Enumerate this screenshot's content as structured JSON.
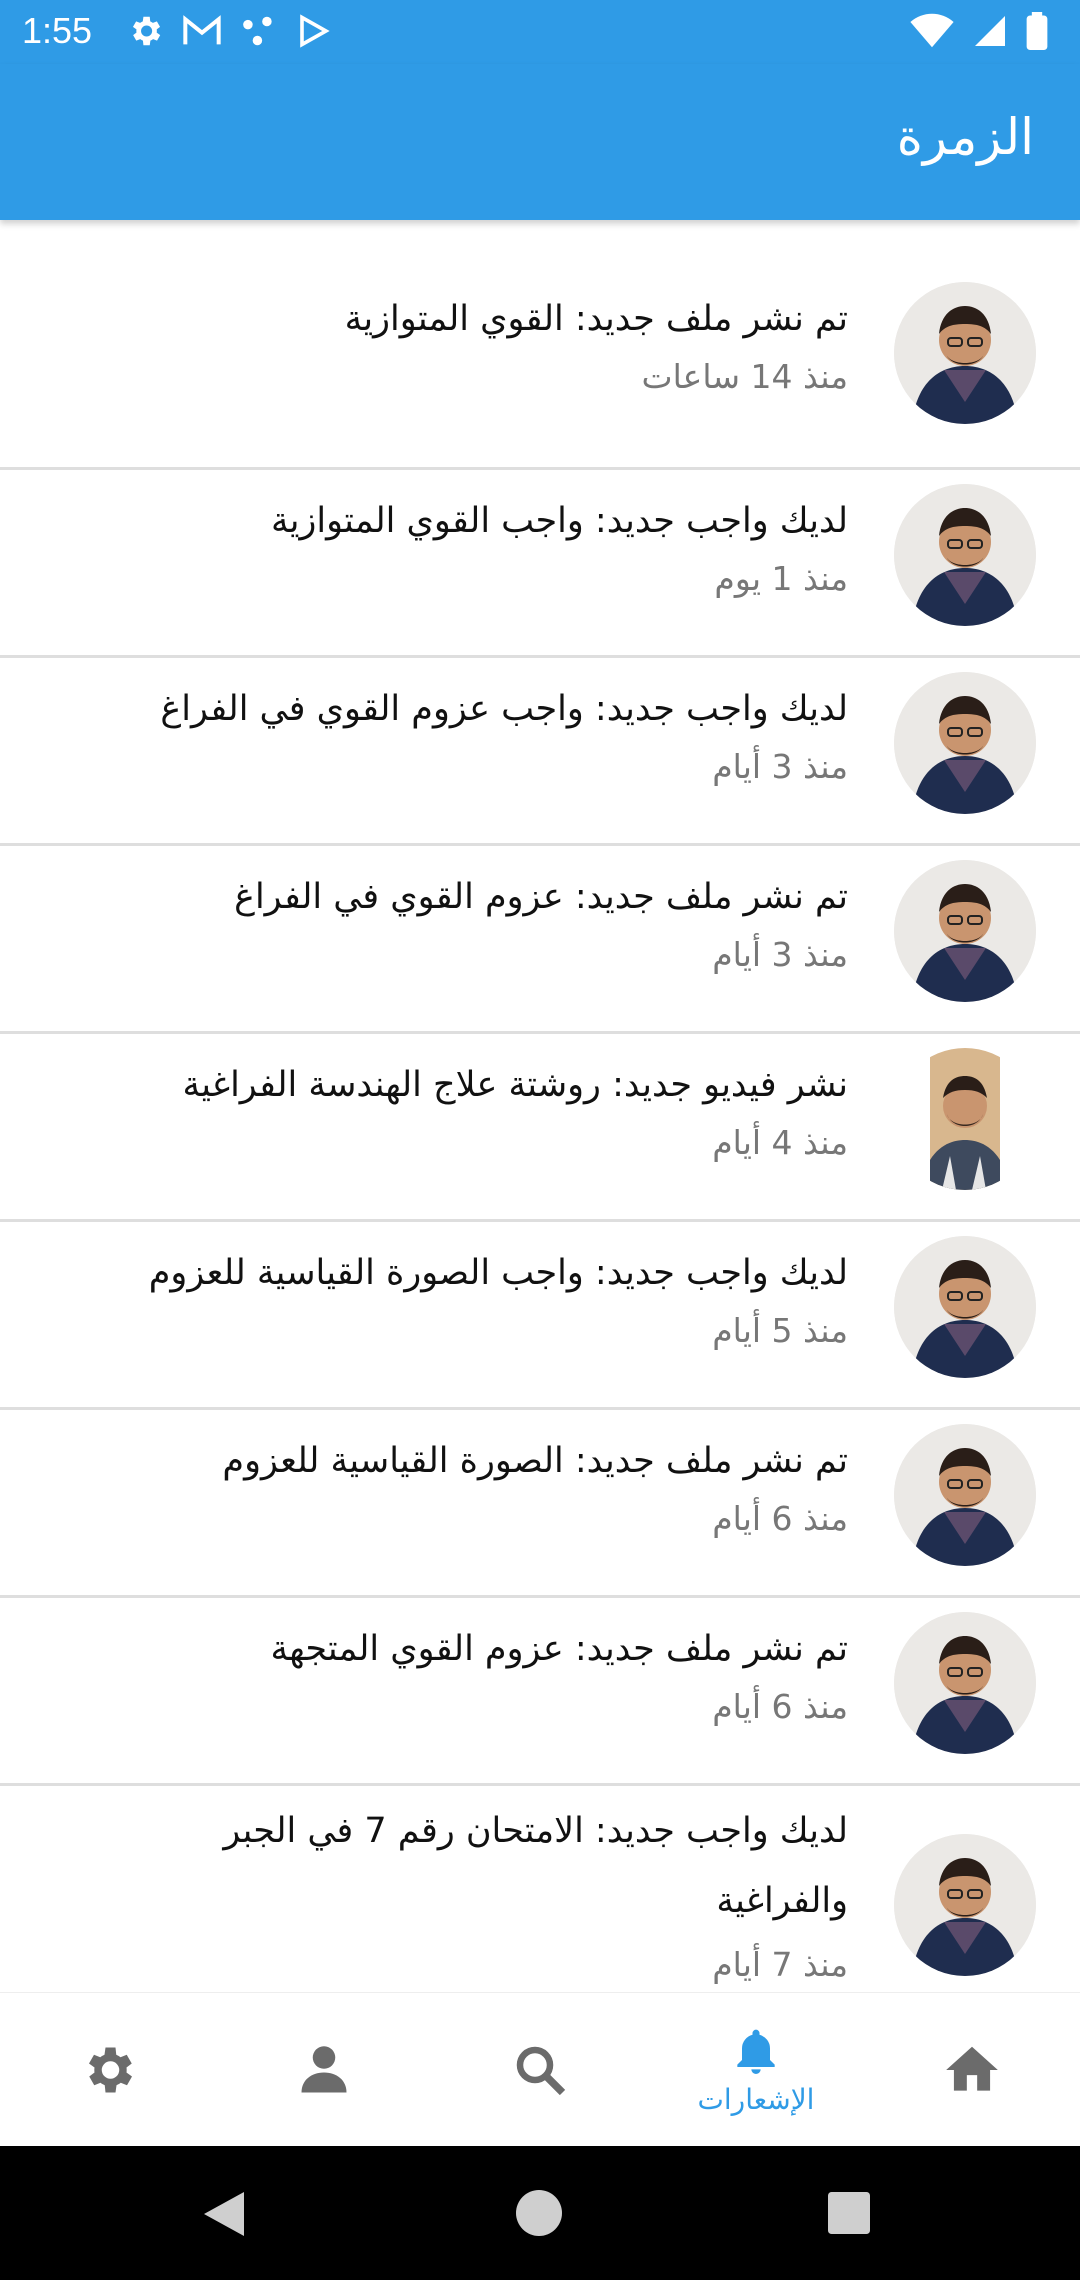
{
  "status_bar": {
    "time": "1:55"
  },
  "app_bar": {
    "title": "الزمرة"
  },
  "notifications": [
    {
      "title": "تم نشر ملف جديد: القوي المتوازية",
      "time": "منذ 14 ساعات",
      "avatar": "teacher"
    },
    {
      "title": "لديك واجب جديد: واجب القوي المتوازية",
      "time": "منذ 1 يوم",
      "avatar": "teacher"
    },
    {
      "title": "لديك واجب جديد: واجب عزوم القوي في الفراغ",
      "time": "منذ 3 أيام",
      "avatar": "teacher"
    },
    {
      "title": "تم نشر ملف جديد: عزوم القوي في الفراغ",
      "time": "منذ 3 أيام",
      "avatar": "teacher"
    },
    {
      "title": "نشر فيديو جديد: روشتة علاج الهندسة الفراغية",
      "time": "منذ 4 أيام",
      "avatar": "young"
    },
    {
      "title": "لديك واجب جديد: واجب الصورة القياسية للعزوم",
      "time": "منذ 5 أيام",
      "avatar": "teacher"
    },
    {
      "title": "تم نشر ملف جديد: الصورة القياسية للعزوم",
      "time": "منذ 6 أيام",
      "avatar": "teacher"
    },
    {
      "title": "تم نشر ملف جديد: عزوم القوي المتجهة",
      "time": "منذ 6 أيام",
      "avatar": "teacher"
    },
    {
      "title": "لديك واجب جديد: الامتحان رقم 7 في الجبر والفراغية",
      "time": "منذ 7 أيام",
      "avatar": "teacher"
    }
  ],
  "bottom_nav": {
    "active_label": "الإشعارات",
    "items": [
      "settings-icon",
      "profile-icon",
      "search-icon",
      "bell-icon",
      "home-icon"
    ]
  },
  "colors": {
    "primary": "#2f9be6",
    "nav_inactive": "#6b6b6b"
  }
}
